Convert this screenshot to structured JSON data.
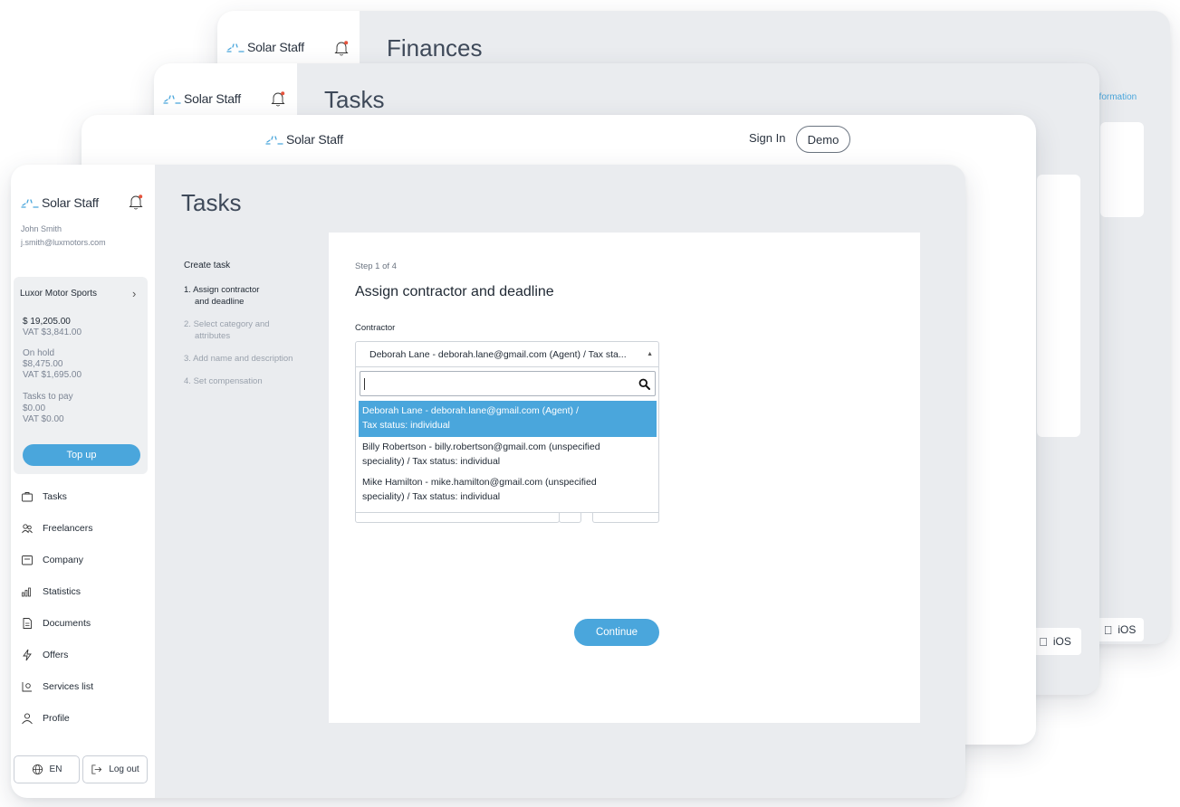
{
  "brand": {
    "name": "Solar Staff"
  },
  "back_windows": {
    "finances": {
      "title": "Finances",
      "link": "nformation",
      "ios_label": "iOS"
    },
    "tasks": {
      "title": "Tasks",
      "ios_label": "iOS"
    },
    "signin": {
      "sign_in": "Sign In",
      "demo": "Demo"
    }
  },
  "sidebar": {
    "user_name": "John Smith",
    "user_email": "j.smith@luxmotors.com",
    "account": {
      "company": "Luxor Motor Sports",
      "balance": "$ 19,205.00",
      "balance_vat": "VAT $3,841.00",
      "on_hold_label": "On hold",
      "on_hold": "$8,475.00",
      "on_hold_vat": "VAT $1,695.00",
      "tasks_to_pay_label": "Tasks to pay",
      "tasks_to_pay": "$0.00",
      "tasks_to_pay_vat": "VAT $0.00",
      "top_up": "Top up"
    },
    "nav": [
      {
        "label": "Tasks",
        "icon": "briefcase-icon"
      },
      {
        "label": "Freelancers",
        "icon": "people-icon"
      },
      {
        "label": "Company",
        "icon": "building-icon"
      },
      {
        "label": "Statistics",
        "icon": "bar-chart-icon"
      },
      {
        "label": "Documents",
        "icon": "document-icon"
      },
      {
        "label": "Offers",
        "icon": "lightning-icon"
      },
      {
        "label": "Services list",
        "icon": "services-icon"
      },
      {
        "label": "Profile",
        "icon": "user-icon"
      }
    ],
    "language": "EN",
    "logout": "Log out"
  },
  "page": {
    "title": "Tasks",
    "steps_title": "Create task",
    "steps": [
      {
        "num": "1.",
        "line1": "Assign contractor",
        "line2": "and deadline",
        "active": true
      },
      {
        "num": "2.",
        "line1": "Select category and",
        "line2": "attributes",
        "active": false
      },
      {
        "num": "3.",
        "line1": "Add name and description",
        "line2": "",
        "active": false
      },
      {
        "num": "4.",
        "line1": "Set compensation",
        "line2": "",
        "active": false
      }
    ],
    "form": {
      "step_of": "Step 1 of 4",
      "heading": "Assign contractor and deadline",
      "contractor_label": "Contractor",
      "contractor_value": "Deborah Lane - deborah.lane@gmail.com (Agent) / Tax sta...",
      "search_value": "",
      "options": [
        {
          "line1": "Deborah Lane - deborah.lane@gmail.com (Agent) /",
          "line2": "Tax status: individual",
          "selected": true
        },
        {
          "line1": "Billy Robertson - billy.robertson@gmail.com (unspecified",
          "line2": "speciality) / Tax status: individual",
          "selected": false
        },
        {
          "line1": "Mike Hamilton - mike.hamilton@gmail.com (unspecified",
          "line2": "speciality) / Tax status: individual",
          "selected": false
        }
      ],
      "continue": "Continue"
    }
  },
  "colors": {
    "accent": "#4aa6dc",
    "notification_dot": "#e5533d",
    "background": "#eaecef"
  }
}
